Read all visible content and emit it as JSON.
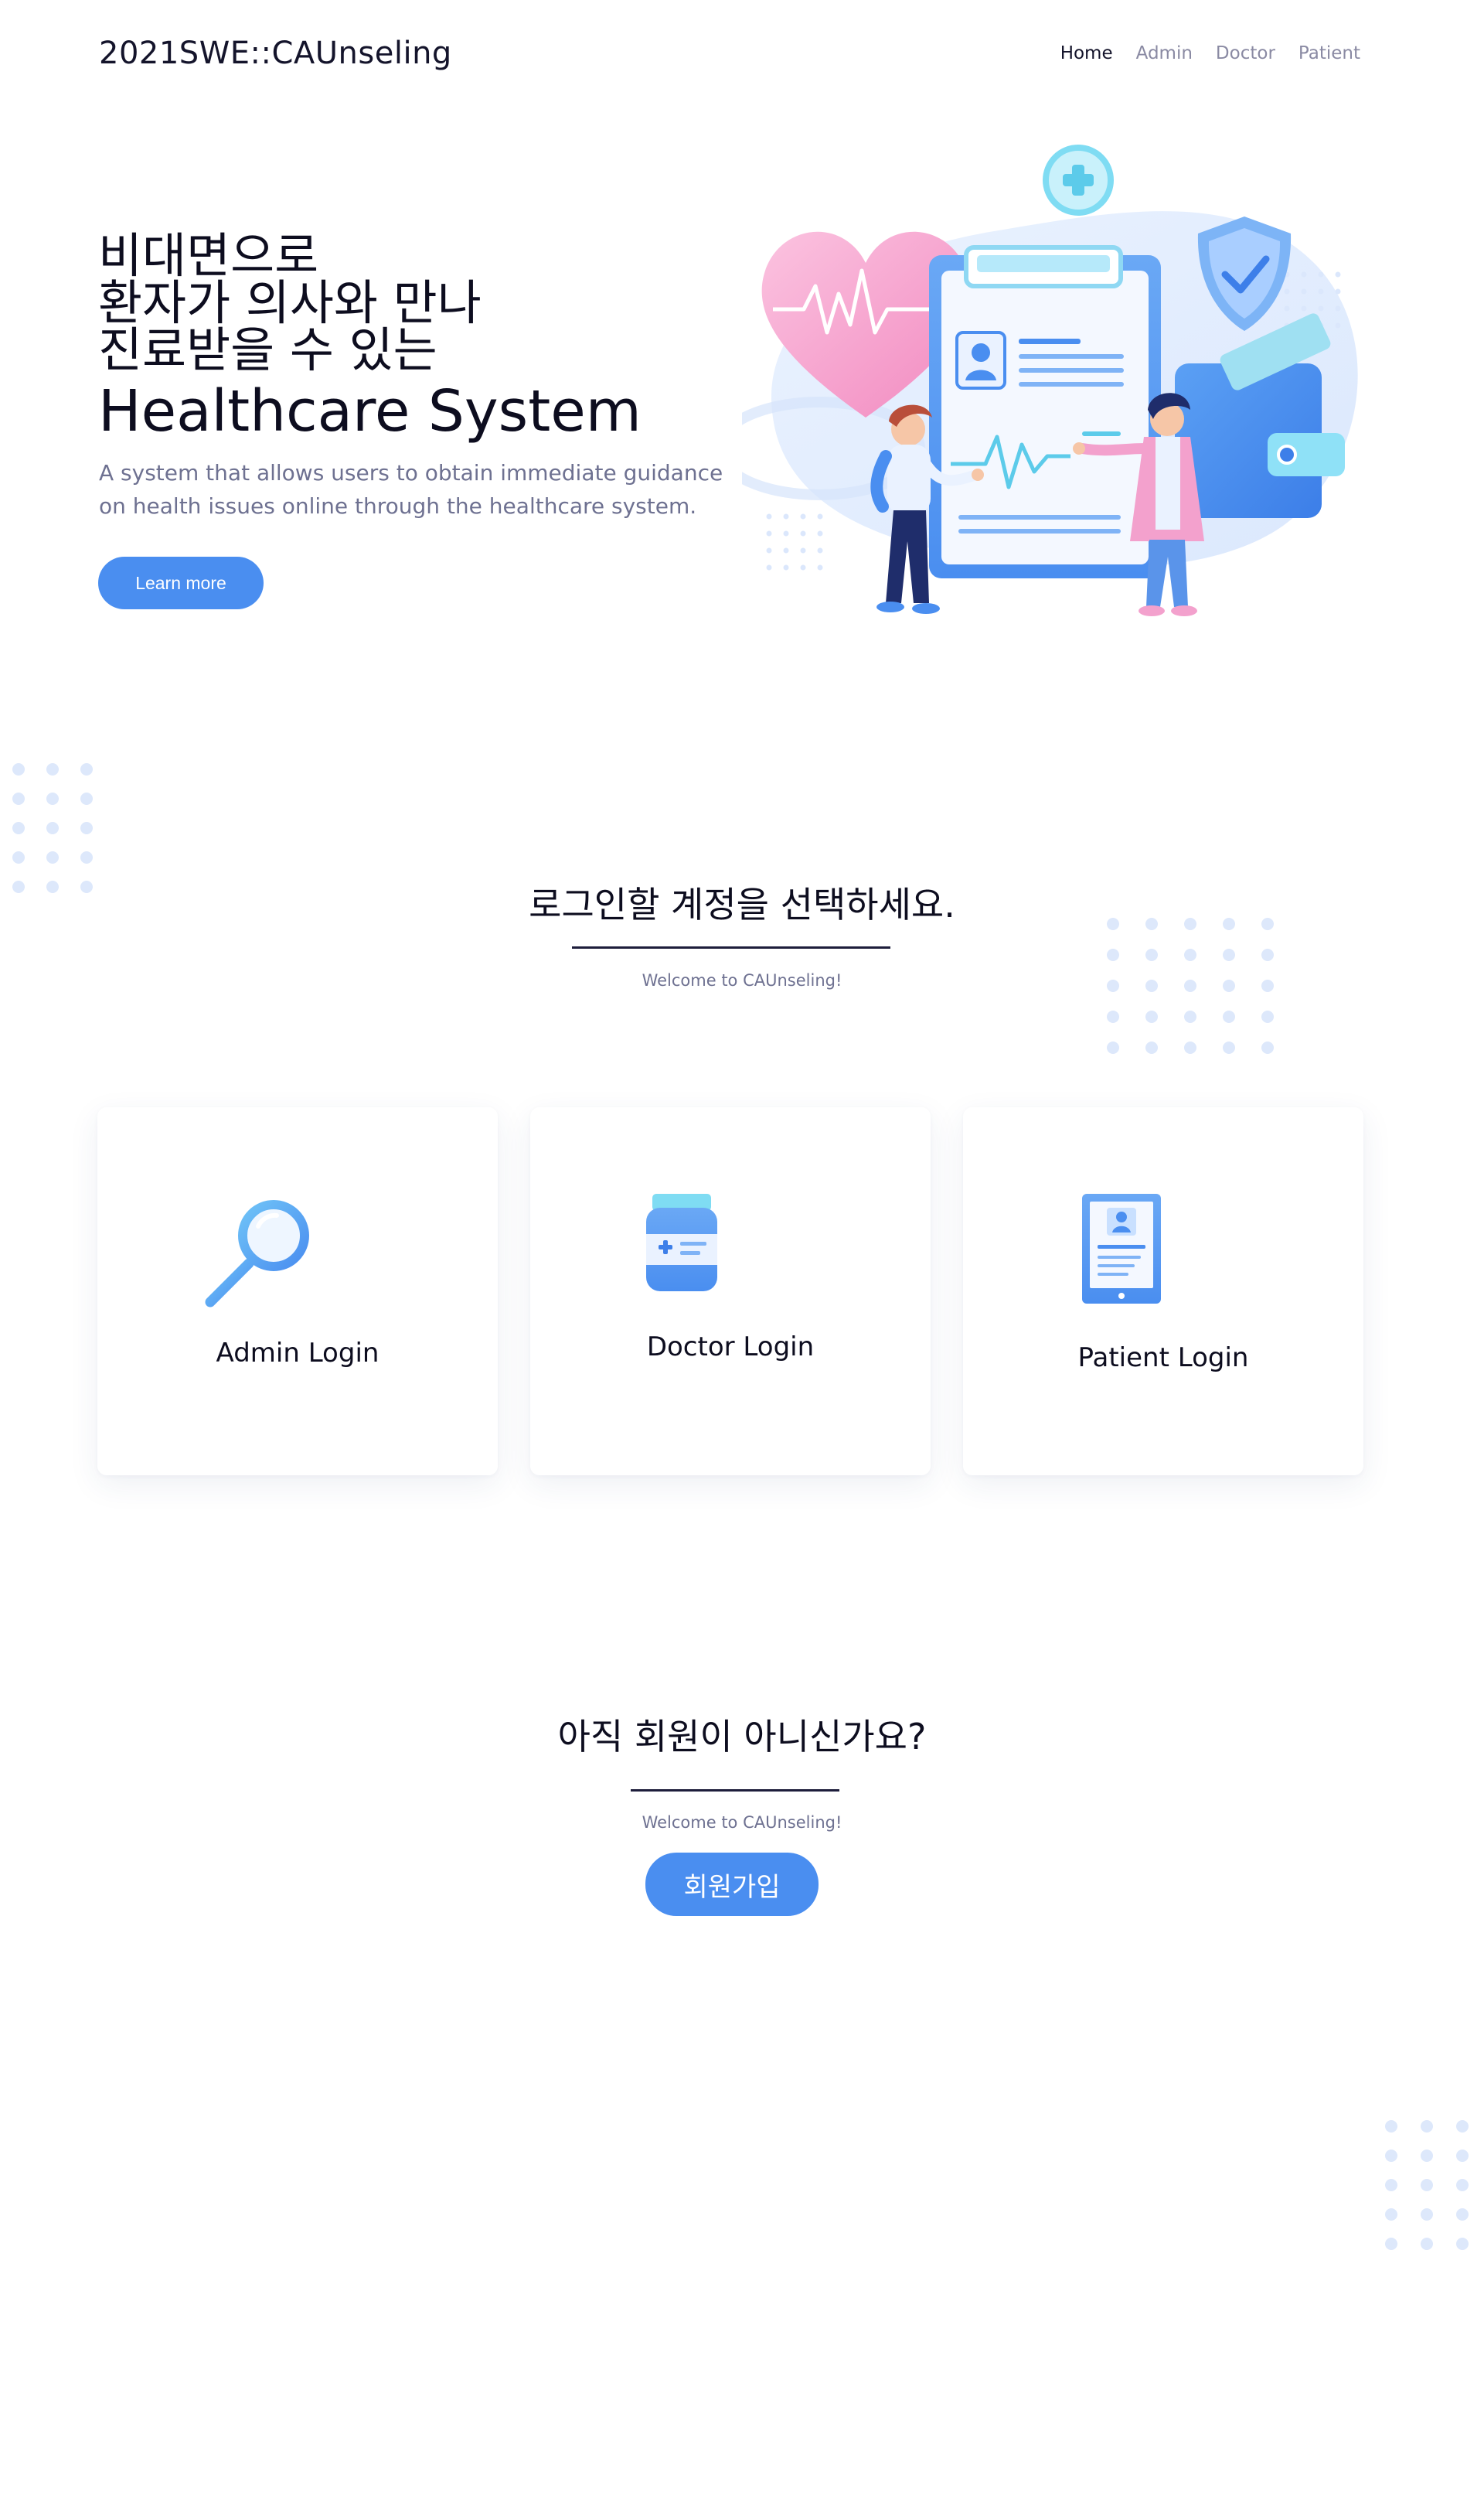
{
  "brand": "2021SWE::CAUnseling",
  "nav": {
    "items": [
      "Home",
      "Admin",
      "Doctor",
      "Patient"
    ],
    "active": "Home"
  },
  "hero": {
    "title_lines": [
      "비대면으로",
      "환자가 의사와 만나",
      "진료받을 수 있는"
    ],
    "title_big": "Healthcare System",
    "description": "A system that allows users to obtain immediate guidance on health issues online through the healthcare system.",
    "cta_label": "Learn more",
    "illustration_icon": "healthcare-illustration"
  },
  "login_section": {
    "title": "로그인할 계정을 선택하세요.",
    "subtitle": "Welcome to CAUnseling!",
    "cards": [
      {
        "label": "Admin Login",
        "icon": "magnifier-icon"
      },
      {
        "label": "Doctor Login",
        "icon": "medicine-bottle-icon"
      },
      {
        "label": "Patient Login",
        "icon": "patient-tablet-icon"
      }
    ]
  },
  "signup_section": {
    "title": "아직 회원이 아니신가요?",
    "subtitle": "Welcome to CAUnseling!",
    "button_label": "회원가입"
  },
  "colors": {
    "accent": "#4a8ef0",
    "text_dark": "#0d0d1f",
    "text_muted": "#6e7191",
    "dot_color": "#dde8fb",
    "pink": "#f7a8cf"
  }
}
